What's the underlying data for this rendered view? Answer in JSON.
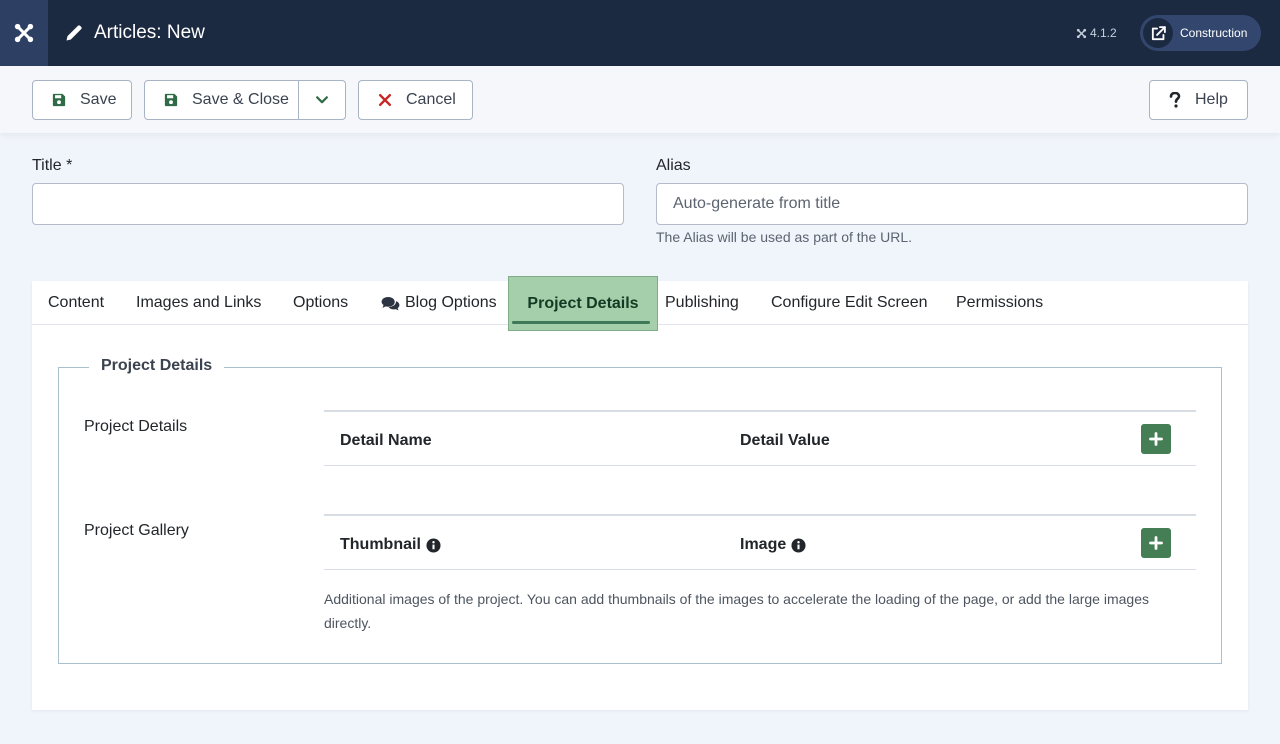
{
  "header": {
    "page_title": "Articles: New",
    "version": "4.1.2",
    "site_label": "Construction"
  },
  "toolbar": {
    "save_label": "Save",
    "save_close_label": "Save & Close",
    "cancel_label": "Cancel",
    "help_label": "Help"
  },
  "form": {
    "title_label": "Title *",
    "title_value": "",
    "alias_label": "Alias",
    "alias_placeholder": "Auto-generate from title",
    "alias_hint": "The Alias will be used as part of the URL."
  },
  "tabs": [
    {
      "label": "Content"
    },
    {
      "label": "Images and Links"
    },
    {
      "label": "Options"
    },
    {
      "label": "Blog Options"
    },
    {
      "label": "Project Details",
      "active": true
    },
    {
      "label": "Publishing"
    },
    {
      "label": "Configure Edit Screen"
    },
    {
      "label": "Permissions"
    }
  ],
  "project_panel": {
    "legend": "Project Details",
    "details_label": "Project Details",
    "details_columns": [
      "Detail Name",
      "Detail Value"
    ],
    "gallery_label": "Project Gallery",
    "gallery_columns": [
      "Thumbnail",
      "Image"
    ],
    "gallery_description": "Additional images of the project. You can add thumbnails of the images to accelerate the loading of the page, or add the large images directly."
  },
  "colors": {
    "header_bg": "#1c2a41",
    "accent_green": "#457d54",
    "active_tab_bg": "#a5ceab",
    "cancel_red": "#c52827"
  }
}
